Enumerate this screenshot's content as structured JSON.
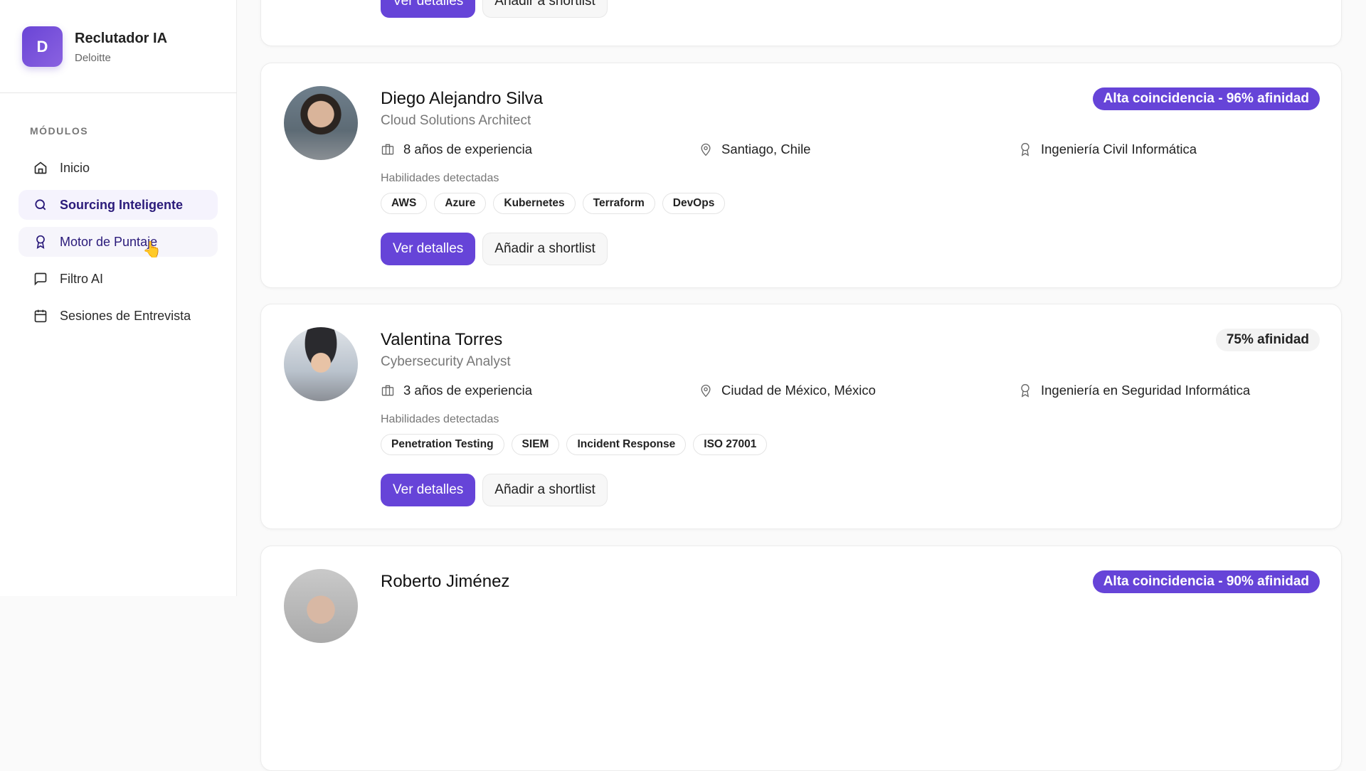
{
  "brand": {
    "initial": "D",
    "title": "Reclutador IA",
    "subtitle": "Deloitte"
  },
  "sidebar": {
    "section": "MÓDULOS",
    "items": [
      {
        "label": "Inicio",
        "icon": "home-icon"
      },
      {
        "label": "Sourcing Inteligente",
        "icon": "search-icon",
        "active": true
      },
      {
        "label": "Motor de Puntaje",
        "icon": "award-icon",
        "hover": true
      },
      {
        "label": "Filtro AI",
        "icon": "message-icon"
      },
      {
        "label": "Sesiones de Entrevista",
        "icon": "calendar-icon"
      }
    ]
  },
  "common": {
    "skills_label": "Habilidades detectadas",
    "details_label": "Ver detalles",
    "shortlist_label": "Añadir a shortlist"
  },
  "candidates": [
    {
      "name": "Diego Alejandro Silva",
      "role": "Cloud Solutions Architect",
      "experience": "8 años de experiencia",
      "location": "Santiago, Chile",
      "education": "Ingeniería Civil Informática",
      "badge": "Alta coincidencia - 96% afinidad",
      "skills": [
        "AWS",
        "Azure",
        "Kubernetes",
        "Terraform",
        "DevOps"
      ]
    },
    {
      "name": "Valentina Torres",
      "role": "Cybersecurity Analyst",
      "experience": "3 años de experiencia",
      "location": "Ciudad de México, México",
      "education": "Ingeniería en Seguridad Informática",
      "badge": "75% afinidad",
      "skills": [
        "Penetration Testing",
        "SIEM",
        "Incident Response",
        "ISO 27001"
      ]
    },
    {
      "name": "Roberto Jiménez",
      "badge": "Alta coincidencia - 90% afinidad"
    }
  ],
  "colors": {
    "accent": "#6644d8"
  }
}
